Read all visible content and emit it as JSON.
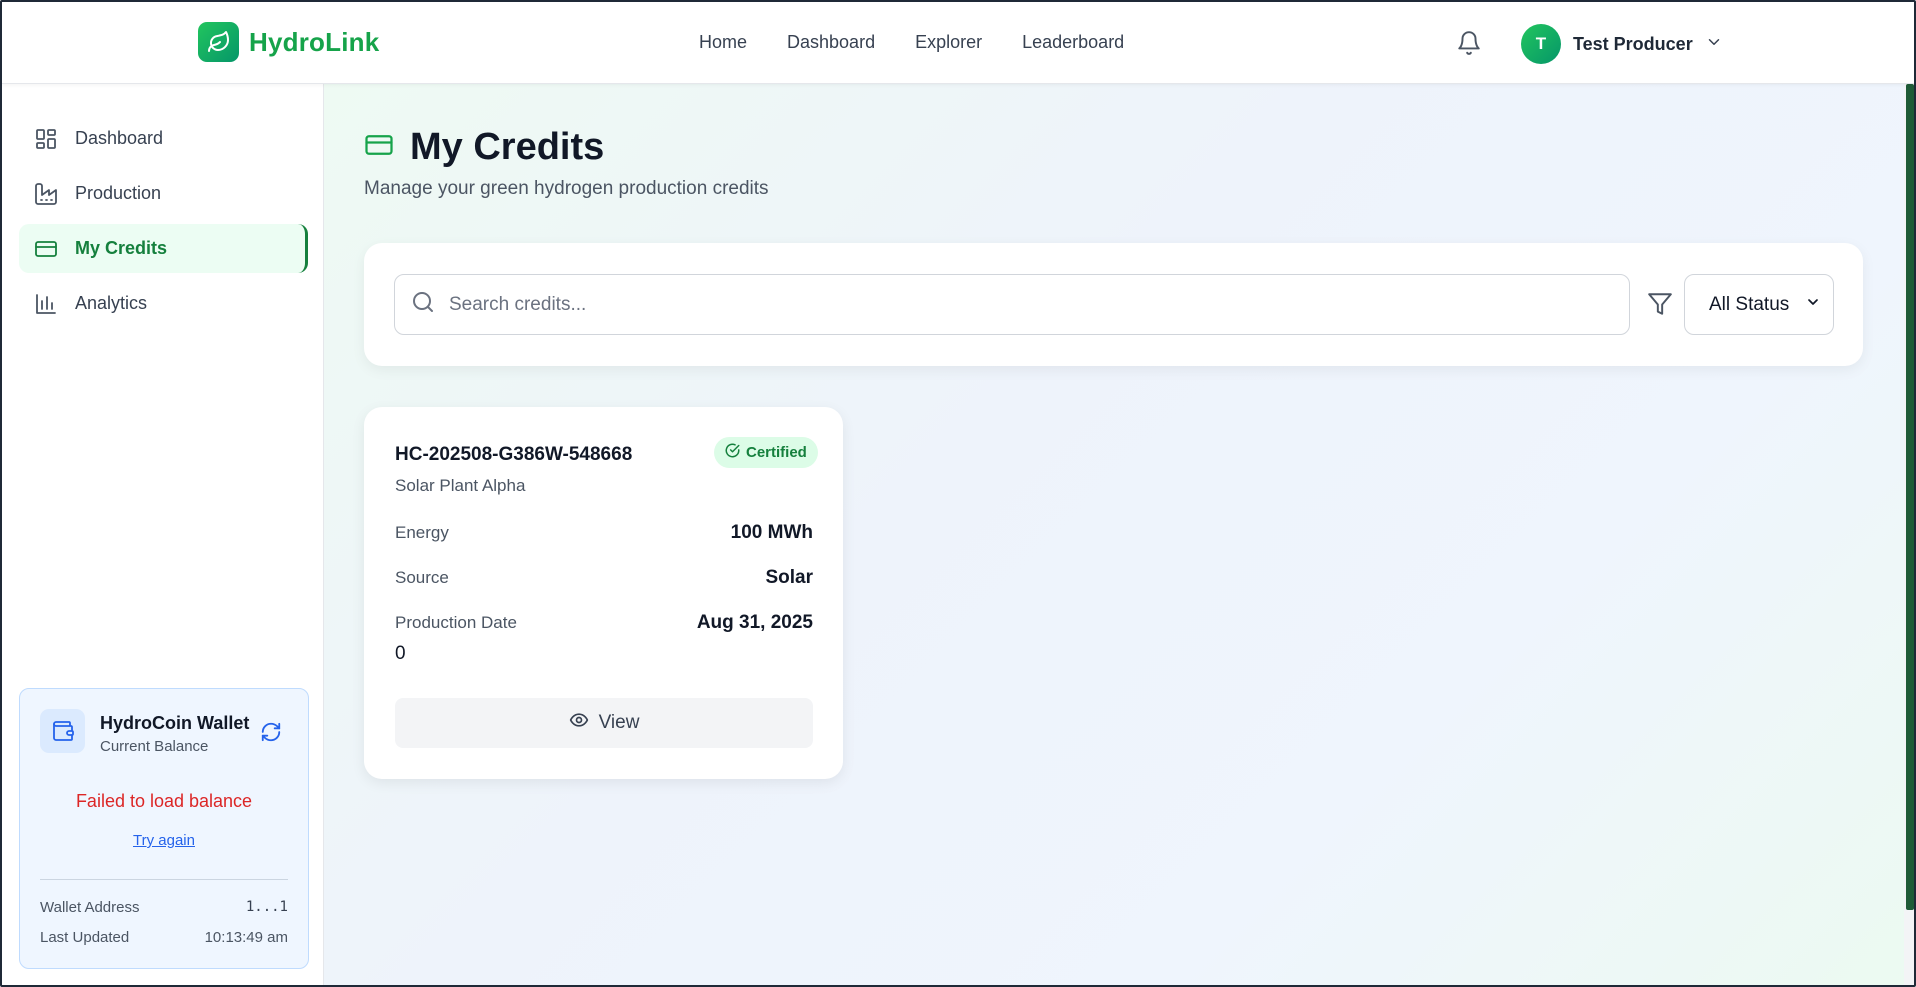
{
  "app": {
    "name": "HydroLink"
  },
  "topnav": {
    "items": [
      "Home",
      "Dashboard",
      "Explorer",
      "Leaderboard"
    ]
  },
  "user": {
    "initial": "T",
    "name": "Test Producer"
  },
  "sidebar": {
    "items": [
      {
        "label": "Dashboard",
        "icon": "layout-grid-icon"
      },
      {
        "label": "Production",
        "icon": "factory-icon"
      },
      {
        "label": "My Credits",
        "icon": "credit-card-icon",
        "active": true
      },
      {
        "label": "Analytics",
        "icon": "bar-chart-icon"
      }
    ]
  },
  "wallet": {
    "title": "HydroCoin Wallet",
    "subtitle": "Current Balance",
    "error": "Failed to load balance",
    "retry": "Try again",
    "address_label": "Wallet Address",
    "address_value": "1...1",
    "updated_label": "Last Updated",
    "updated_value": "10:13:49 am"
  },
  "page": {
    "title": "My Credits",
    "subtitle": "Manage your green hydrogen production credits"
  },
  "filters": {
    "search_placeholder": "Search credits...",
    "status_selected": "All Status"
  },
  "credits": [
    {
      "id": "HC-202508-G386W-548668",
      "status": "Certified",
      "plant": "Solar Plant Alpha",
      "energy_label": "Energy",
      "energy_value": "100 MWh",
      "source_label": "Source",
      "source_value": "Solar",
      "date_label": "Production Date",
      "date_value": "Aug 31, 2025",
      "extra": "0",
      "view_label": "View"
    }
  ],
  "colors": {
    "brand_green": "#16a34a",
    "active_green": "#15803d",
    "error_red": "#dc2626",
    "link_blue": "#2563eb"
  }
}
